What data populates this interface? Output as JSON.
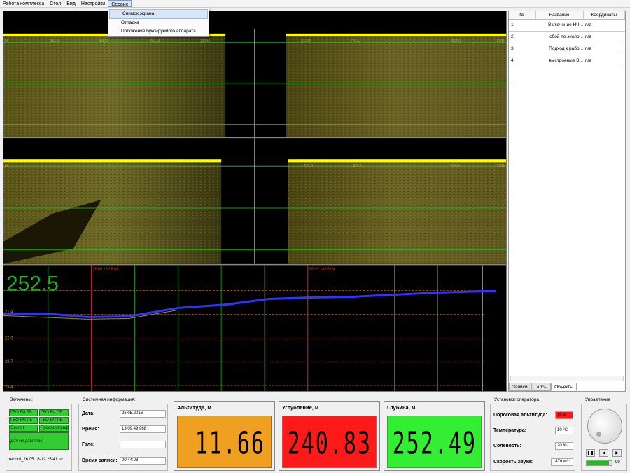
{
  "menu": [
    "Работа комплекса",
    "Стол",
    "Вид",
    "Настройки",
    "Сервис"
  ],
  "dropdown": [
    "Снимок экрана",
    "Отладка",
    "Положение буксируемого аппарата"
  ],
  "sonar": {
    "top_scale": [
      "0",
      "60.0",
      "50.0",
      "40.0",
      "20.0",
      "20.0",
      "40.0",
      "60.0",
      "100"
    ],
    "bottom_scale": [
      "0",
      "20.0",
      "40.0",
      "60.0",
      "100"
    ],
    "depth_value": "252.5",
    "markers": [
      "26.05 13:08:48",
      "26.05 13:05:04"
    ],
    "y_ticks": [
      "21.4",
      "22.0",
      "22.7",
      "23.4"
    ]
  },
  "objects": {
    "headers": [
      "№",
      "Название",
      "Координаты"
    ],
    "rows": [
      {
        "n": "1",
        "name": "Включение НЧ...",
        "coord": "n/a"
      },
      {
        "n": "2",
        "name": "сбой по эхоло...",
        "coord": "n/a"
      },
      {
        "n": "3",
        "name": "Подход к рабо...",
        "coord": "n/a"
      },
      {
        "n": "4",
        "name": "выстроеные В...",
        "coord": "n/a"
      }
    ],
    "tabs": [
      "Записи",
      "Галсы",
      "Объекты"
    ]
  },
  "enabled": {
    "title": "Включены:",
    "buttons": [
      "ГБО ВЧ ЛБ",
      "ГБО ВЧ ПБ",
      "ГБО НЧ ЛБ",
      "ГБО НЧ ПБ",
      "Эхолот",
      "Профилограф",
      "Датчик давления"
    ],
    "file": "record_26.05.16-12.25.41.trc"
  },
  "sysinfo": {
    "title": "Системная информация:",
    "date_label": "Дата:",
    "date": "26.05.2016",
    "time_label": "Время:",
    "time": "13:09:49.968",
    "gals_label": "Галс:",
    "gals": "",
    "rec_label": "Время записи:",
    "rec": "00:44:08"
  },
  "gauges": [
    {
      "title": "Альтитуда, м",
      "value": "11.66",
      "color": "#f0a020"
    },
    {
      "title": "Углубление, м",
      "value": "240.83",
      "color": "#ff1a1a"
    },
    {
      "title": "Глубина, м",
      "value": "252.49",
      "color": "#33ee33"
    }
  ],
  "operator": {
    "title": "Установки оператора",
    "alt_label": "Пороговая альтитуда:",
    "alt_value": "10 м",
    "temp_label": "Температура:",
    "temp_value": "10 °C",
    "sal_label": "Соленость:",
    "sal_value": "20 ‰",
    "snd_label": "Скорость звука:",
    "snd_value": "1476 м/с"
  },
  "control": {
    "title": "Управление",
    "volume": "99",
    "volume_fraction": 0.9
  }
}
